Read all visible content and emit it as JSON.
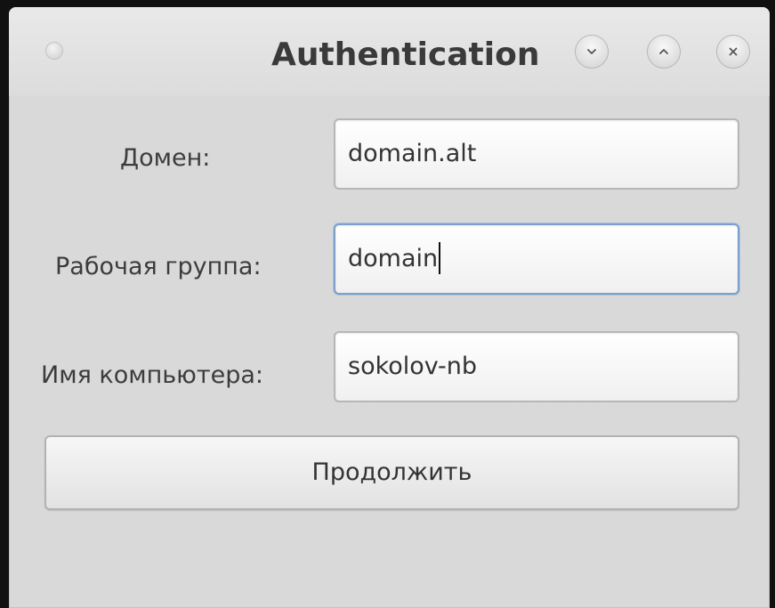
{
  "window": {
    "title": "Authentication",
    "controls": {
      "minimize": "chevron-down-icon",
      "maximize": "chevron-up-icon",
      "close": "close-icon"
    }
  },
  "form": {
    "domain": {
      "label": "Домен:",
      "value": "domain.alt"
    },
    "workgroup": {
      "label": "Рабочая группа:",
      "value": "domain"
    },
    "hostname": {
      "label": "Имя компьютера:",
      "value": "sokolov-nb"
    }
  },
  "actions": {
    "continue_label": "Продолжить"
  },
  "colors": {
    "window_bg": "#d9d9d9",
    "focus_border": "#7d9fc9",
    "text": "#3c3c3c"
  }
}
